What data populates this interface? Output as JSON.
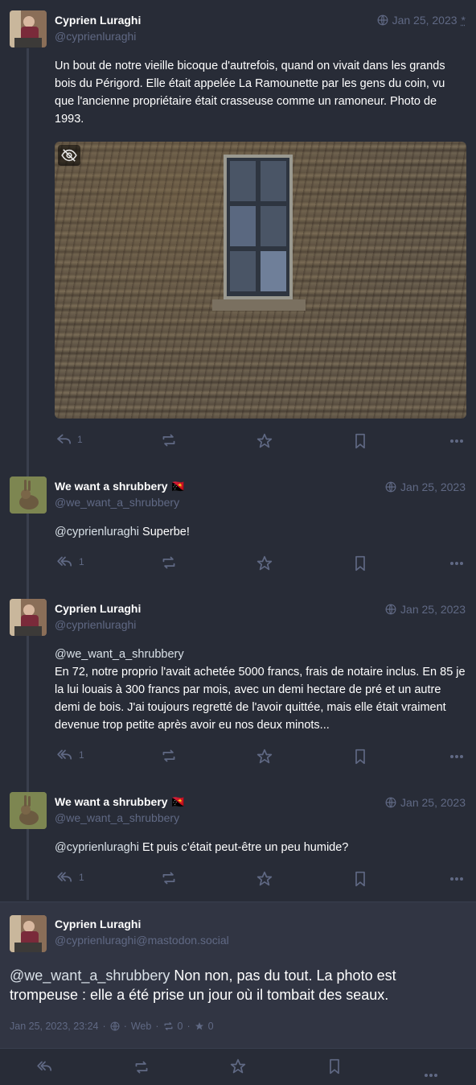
{
  "thread": [
    {
      "display_name": "Cyprien Luraghi",
      "handle": "@cyprienluraghi",
      "date": "Jan 25, 2023",
      "edited_marker": "*",
      "content": "Un bout de notre vieille bicoque d'autrefois, quand on vivait dans les grands bois du Périgord. Elle était appelée La Ramounette par les gens du coin, vu que l'ancienne propriétaire était crasseuse comme un ramoneur. Photo de 1993.",
      "replies": "1"
    },
    {
      "display_name": "We want a shrubbery",
      "flag": "🇵🇬",
      "handle": "@we_want_a_shrubbery",
      "date": "Jan 25, 2023",
      "mention": "@cyprienluraghi",
      "content": " Superbe!",
      "replies": "1"
    },
    {
      "display_name": "Cyprien Luraghi",
      "handle": "@cyprienluraghi",
      "date": "Jan 25, 2023",
      "mention": "@we_want_a_shrubbery",
      "content": "En 72, notre proprio l'avait achetée 5000 francs, frais de notaire inclus. En 85 je la lui louais à 300 francs par mois, avec un demi hectare de pré et un autre demi de bois. J'ai toujours regretté de l'avoir quittée, mais elle était vraiment devenue trop petite après avoir eu nos deux minots...",
      "replies": "1"
    },
    {
      "display_name": "We want a shrubbery",
      "flag": "🇵🇬",
      "handle": "@we_want_a_shrubbery",
      "date": "Jan 25, 2023",
      "mention": "@cyprienluraghi",
      "content": " Et puis c’était peut-être un peu humide?",
      "replies": "1"
    }
  ],
  "focused": {
    "display_name": "Cyprien Luraghi",
    "handle": "@cyprienluraghi@mastodon.social",
    "mention": "@we_want_a_shrubbery",
    "content": " Non non, pas du tout. La photo est trompeuse : elle a été prise un jour où il tombait des seaux.",
    "timestamp": "Jan 25, 2023, 23:24",
    "app": "Web",
    "boosts": "0",
    "favourites": "0"
  },
  "colors": {
    "background": "#282c37",
    "focused_background": "#313543",
    "muted": "#606984",
    "text": "#ffffff"
  },
  "icons": [
    "globe-icon",
    "reply-icon",
    "reply-all-icon",
    "boost-icon",
    "star-icon",
    "bookmark-icon",
    "more-icon",
    "eye-slash-icon"
  ]
}
